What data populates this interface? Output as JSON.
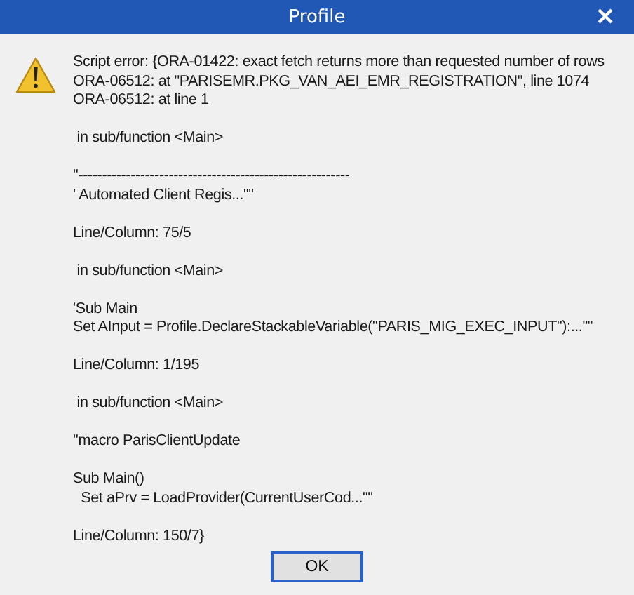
{
  "window": {
    "title": "Profile"
  },
  "message": {
    "paragraphs": [
      [
        "Script error: {ORA-01422: exact fetch returns more than requested number of rows",
        "ORA-06512: at \"PARISEMR.PKG_VAN_AEI_EMR_REGISTRATION\", line 1074",
        "ORA-06512: at line 1"
      ],
      [
        " in sub/function <Main>"
      ],
      [
        "''---------------------------------------------------------",
        "' Automated Client Regis...\"\""
      ],
      [
        "Line/Column: 75/5"
      ],
      [
        " in sub/function <Main>"
      ],
      [
        "'Sub Main",
        "Set AInput = Profile.DeclareStackableVariable(\"PARIS_MIG_EXEC_INPUT\"):...\"\""
      ],
      [
        "Line/Column: 1/195"
      ],
      [
        " in sub/function <Main>"
      ],
      [
        "''macro ParisClientUpdate"
      ],
      [
        "Sub Main()",
        "  Set aPrv = LoadProvider(CurrentUserCod...\"\""
      ],
      [
        "Line/Column: 150/7}"
      ]
    ]
  },
  "buttons": [
    {
      "label": "OK",
      "default": true
    }
  ]
}
